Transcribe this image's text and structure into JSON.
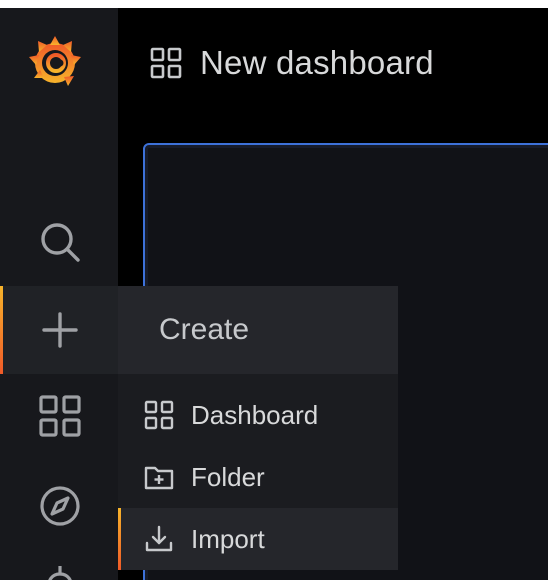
{
  "header": {
    "title": "New dashboard",
    "icon": "dashboard-grid-icon"
  },
  "sidebar": {
    "logo": "grafana-logo",
    "items": [
      {
        "icon": "search-icon",
        "active": false
      },
      {
        "icon": "plus-icon",
        "active": true
      },
      {
        "icon": "dashboards-grid-icon",
        "active": false
      },
      {
        "icon": "compass-icon",
        "active": false
      },
      {
        "icon": "bell-icon",
        "active": false
      }
    ]
  },
  "create_menu": {
    "title": "Create",
    "items": [
      {
        "label": "Dashboard",
        "icon": "dashboard-grid-icon",
        "highlighted": false
      },
      {
        "label": "Folder",
        "icon": "folder-plus-icon",
        "highlighted": false
      },
      {
        "label": "Import",
        "icon": "import-icon",
        "highlighted": true
      }
    ]
  },
  "colors": {
    "accent_orange": "#f05a28",
    "accent_yellow": "#f7b42b",
    "panel_border": "#3d71d9",
    "sidebar_bg": "#17181c",
    "text": "#d8d9da"
  }
}
